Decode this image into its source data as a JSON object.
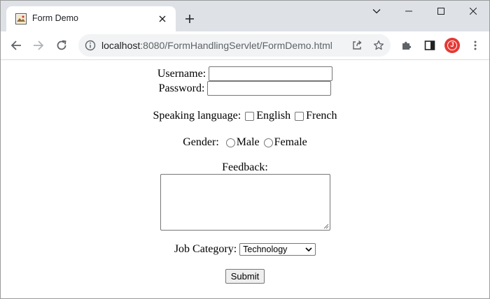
{
  "browser": {
    "tab": {
      "title": "Form Demo",
      "favicon": "image-favicon-icon"
    },
    "new_tab_icon": "plus-icon",
    "window_controls": [
      "chevron-down-icon",
      "minimize-icon",
      "maximize-icon",
      "close-icon"
    ],
    "url": {
      "host": "localhost",
      "path": ":8080/FormHandlingServlet/FormDemo.html"
    },
    "profile_initial": "J"
  },
  "form": {
    "username_label": "Username:",
    "username_value": "",
    "password_label": "Password:",
    "password_value": "",
    "language_label": "Speaking language:",
    "language_options": [
      {
        "label": "English",
        "checked": false
      },
      {
        "label": "French",
        "checked": false
      }
    ],
    "gender_label": "Gender:",
    "gender_options": [
      {
        "label": "Male",
        "selected": false
      },
      {
        "label": "Female",
        "selected": false
      }
    ],
    "feedback_label": "Feedback:",
    "feedback_value": "",
    "job_label": "Job Category:",
    "job_selected": "Technology",
    "submit_label": "Submit"
  }
}
